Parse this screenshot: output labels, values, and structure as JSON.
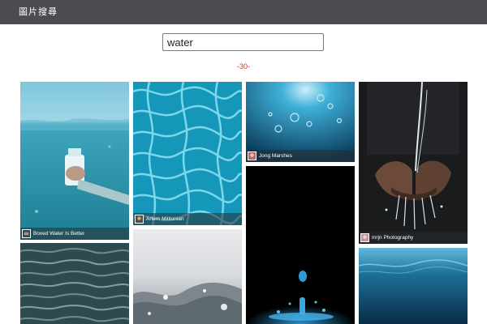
{
  "header": {
    "title": "圖片搜尋"
  },
  "search": {
    "value": "water"
  },
  "results": {
    "count_label": "-30-",
    "photos": [
      {
        "caption": "Boxed Water Is Better",
        "icon": "water-bottle-underwater-photo"
      },
      {
        "caption": "Artem Militonian",
        "icon": "pool-water-ripples-photo"
      },
      {
        "caption": "Jong Marshes",
        "icon": "underwater-bubbles-photo"
      },
      {
        "caption": "mrjn Photography",
        "icon": "water-cupped-hands-photo"
      },
      {
        "caption": "",
        "icon": "ocean-waves-photo"
      },
      {
        "caption": "",
        "icon": "foam-splash-photo"
      },
      {
        "caption": "",
        "icon": "water-droplet-splash-photo"
      },
      {
        "caption": "",
        "icon": "deep-ocean-surface-photo"
      }
    ]
  },
  "colors": {
    "topbar": "#4a4c51",
    "count": "#c0392b"
  }
}
